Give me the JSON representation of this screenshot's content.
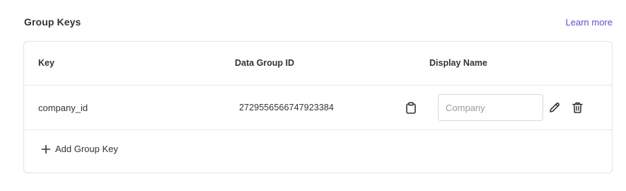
{
  "section": {
    "title": "Group Keys",
    "learn_more": "Learn more"
  },
  "table": {
    "headers": {
      "key": "Key",
      "data_group_id": "Data Group ID",
      "display_name": "Display Name"
    },
    "rows": [
      {
        "key": "company_id",
        "data_group_id": "2729556566747923384",
        "display_name_value": "",
        "display_name_placeholder": "Company"
      }
    ]
  },
  "actions": {
    "add_label": "Add Group Key"
  },
  "icons": {
    "copy": "clipboard-icon",
    "edit": "pencil-icon",
    "delete": "trash-icon",
    "add": "plus-icon"
  },
  "colors": {
    "link": "#5a4fcf",
    "border": "#e3e3e6",
    "text": "#333333"
  }
}
